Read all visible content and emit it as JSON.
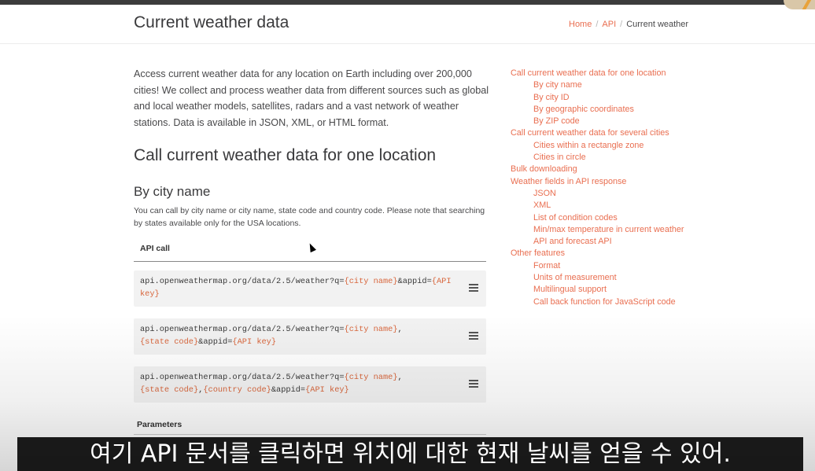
{
  "page": {
    "title": "Current weather data",
    "breadcrumb": {
      "home": "Home",
      "api": "API",
      "current": "Current weather",
      "separator": "/"
    }
  },
  "content": {
    "intro": "Access current weather data for any location on Earth including over 200,000 cities! We collect and process weather data from different sources such as global and local weather models, satellites, radars and a vast network of weather stations. Data is available in JSON, XML, or HTML format.",
    "section_title": "Call current weather data for one location",
    "subsection_title": "By city name",
    "description": "You can call by city name or city name, state code and country code. Please note that searching by states available only for the USA locations.",
    "api_call_header": "API call",
    "api_calls": [
      {
        "prefix": "api.openweathermap.org/data/2.5/weather?q=",
        "p1": "{city name}",
        "mid1": "&appid=",
        "p2": "{API key}"
      },
      {
        "prefix": "api.openweathermap.org/data/2.5/weather?q=",
        "p1": "{city name}",
        "mid1": ",",
        "p2": "{state code}",
        "mid2": "&appid=",
        "p3": "{API key}"
      },
      {
        "prefix": "api.openweathermap.org/data/2.5/weather?q=",
        "p1": "{city name}",
        "mid1": ",",
        "p2": "{state code}",
        "mid2": ",",
        "p3": "{country code}",
        "mid3": "&appid=",
        "p4": "{API key}"
      }
    ],
    "parameters_header": "Parameters"
  },
  "toc": [
    {
      "label": "Call current weather data for one location",
      "level": 1
    },
    {
      "label": "By city name",
      "level": 2
    },
    {
      "label": "By city ID",
      "level": 2
    },
    {
      "label": "By geographic coordinates",
      "level": 2
    },
    {
      "label": "By ZIP code",
      "level": 2
    },
    {
      "label": "Call current weather data for several cities",
      "level": 1
    },
    {
      "label": "Cities within a rectangle zone",
      "level": 2
    },
    {
      "label": "Cities in circle",
      "level": 2
    },
    {
      "label": "Bulk downloading",
      "level": 1
    },
    {
      "label": "Weather fields in API response",
      "level": 1
    },
    {
      "label": "JSON",
      "level": 2
    },
    {
      "label": "XML",
      "level": 2
    },
    {
      "label": "List of condition codes",
      "level": 2
    },
    {
      "label": "Min/max temperature in current weather",
      "level": 2
    },
    {
      "label": "API and forecast API",
      "level": 2
    },
    {
      "label": "Other features",
      "level": 1
    },
    {
      "label": "Format",
      "level": 2
    },
    {
      "label": "Units of measurement",
      "level": 2
    },
    {
      "label": "Multilingual support",
      "level": 2
    },
    {
      "label": "Call back function for JavaScript code",
      "level": 2
    }
  ],
  "subtitle": "여기 API 문서를 클릭하면 위치에 대한 현재 날씨를 얻을 수 있어.",
  "colors": {
    "link": "#e96e50",
    "placeholder": "#d8663c",
    "code_bg": "#f2f2f2",
    "subtitle_bg": "#080808"
  },
  "icons": {
    "copy": "menu-lines-icon",
    "cursor": "mouse-pointer-icon"
  }
}
